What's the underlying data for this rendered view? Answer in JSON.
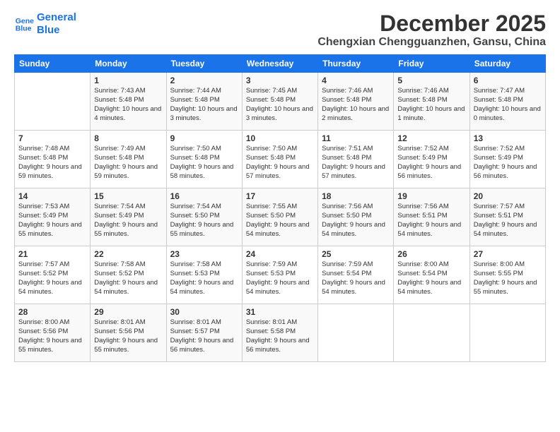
{
  "logo": {
    "line1": "General",
    "line2": "Blue"
  },
  "title": "December 2025",
  "location": "Chengxian Chengguanzhen, Gansu, China",
  "days_of_week": [
    "Sunday",
    "Monday",
    "Tuesday",
    "Wednesday",
    "Thursday",
    "Friday",
    "Saturday"
  ],
  "weeks": [
    [
      {
        "day": "",
        "sunrise": "",
        "sunset": "",
        "daylight": ""
      },
      {
        "day": "1",
        "sunrise": "Sunrise: 7:43 AM",
        "sunset": "Sunset: 5:48 PM",
        "daylight": "Daylight: 10 hours and 4 minutes."
      },
      {
        "day": "2",
        "sunrise": "Sunrise: 7:44 AM",
        "sunset": "Sunset: 5:48 PM",
        "daylight": "Daylight: 10 hours and 3 minutes."
      },
      {
        "day": "3",
        "sunrise": "Sunrise: 7:45 AM",
        "sunset": "Sunset: 5:48 PM",
        "daylight": "Daylight: 10 hours and 3 minutes."
      },
      {
        "day": "4",
        "sunrise": "Sunrise: 7:46 AM",
        "sunset": "Sunset: 5:48 PM",
        "daylight": "Daylight: 10 hours and 2 minutes."
      },
      {
        "day": "5",
        "sunrise": "Sunrise: 7:46 AM",
        "sunset": "Sunset: 5:48 PM",
        "daylight": "Daylight: 10 hours and 1 minute."
      },
      {
        "day": "6",
        "sunrise": "Sunrise: 7:47 AM",
        "sunset": "Sunset: 5:48 PM",
        "daylight": "Daylight: 10 hours and 0 minutes."
      }
    ],
    [
      {
        "day": "7",
        "sunrise": "Sunrise: 7:48 AM",
        "sunset": "Sunset: 5:48 PM",
        "daylight": "Daylight: 9 hours and 59 minutes."
      },
      {
        "day": "8",
        "sunrise": "Sunrise: 7:49 AM",
        "sunset": "Sunset: 5:48 PM",
        "daylight": "Daylight: 9 hours and 59 minutes."
      },
      {
        "day": "9",
        "sunrise": "Sunrise: 7:50 AM",
        "sunset": "Sunset: 5:48 PM",
        "daylight": "Daylight: 9 hours and 58 minutes."
      },
      {
        "day": "10",
        "sunrise": "Sunrise: 7:50 AM",
        "sunset": "Sunset: 5:48 PM",
        "daylight": "Daylight: 9 hours and 57 minutes."
      },
      {
        "day": "11",
        "sunrise": "Sunrise: 7:51 AM",
        "sunset": "Sunset: 5:48 PM",
        "daylight": "Daylight: 9 hours and 57 minutes."
      },
      {
        "day": "12",
        "sunrise": "Sunrise: 7:52 AM",
        "sunset": "Sunset: 5:49 PM",
        "daylight": "Daylight: 9 hours and 56 minutes."
      },
      {
        "day": "13",
        "sunrise": "Sunrise: 7:52 AM",
        "sunset": "Sunset: 5:49 PM",
        "daylight": "Daylight: 9 hours and 56 minutes."
      }
    ],
    [
      {
        "day": "14",
        "sunrise": "Sunrise: 7:53 AM",
        "sunset": "Sunset: 5:49 PM",
        "daylight": "Daylight: 9 hours and 55 minutes."
      },
      {
        "day": "15",
        "sunrise": "Sunrise: 7:54 AM",
        "sunset": "Sunset: 5:49 PM",
        "daylight": "Daylight: 9 hours and 55 minutes."
      },
      {
        "day": "16",
        "sunrise": "Sunrise: 7:54 AM",
        "sunset": "Sunset: 5:50 PM",
        "daylight": "Daylight: 9 hours and 55 minutes."
      },
      {
        "day": "17",
        "sunrise": "Sunrise: 7:55 AM",
        "sunset": "Sunset: 5:50 PM",
        "daylight": "Daylight: 9 hours and 54 minutes."
      },
      {
        "day": "18",
        "sunrise": "Sunrise: 7:56 AM",
        "sunset": "Sunset: 5:50 PM",
        "daylight": "Daylight: 9 hours and 54 minutes."
      },
      {
        "day": "19",
        "sunrise": "Sunrise: 7:56 AM",
        "sunset": "Sunset: 5:51 PM",
        "daylight": "Daylight: 9 hours and 54 minutes."
      },
      {
        "day": "20",
        "sunrise": "Sunrise: 7:57 AM",
        "sunset": "Sunset: 5:51 PM",
        "daylight": "Daylight: 9 hours and 54 minutes."
      }
    ],
    [
      {
        "day": "21",
        "sunrise": "Sunrise: 7:57 AM",
        "sunset": "Sunset: 5:52 PM",
        "daylight": "Daylight: 9 hours and 54 minutes."
      },
      {
        "day": "22",
        "sunrise": "Sunrise: 7:58 AM",
        "sunset": "Sunset: 5:52 PM",
        "daylight": "Daylight: 9 hours and 54 minutes."
      },
      {
        "day": "23",
        "sunrise": "Sunrise: 7:58 AM",
        "sunset": "Sunset: 5:53 PM",
        "daylight": "Daylight: 9 hours and 54 minutes."
      },
      {
        "day": "24",
        "sunrise": "Sunrise: 7:59 AM",
        "sunset": "Sunset: 5:53 PM",
        "daylight": "Daylight: 9 hours and 54 minutes."
      },
      {
        "day": "25",
        "sunrise": "Sunrise: 7:59 AM",
        "sunset": "Sunset: 5:54 PM",
        "daylight": "Daylight: 9 hours and 54 minutes."
      },
      {
        "day": "26",
        "sunrise": "Sunrise: 8:00 AM",
        "sunset": "Sunset: 5:54 PM",
        "daylight": "Daylight: 9 hours and 54 minutes."
      },
      {
        "day": "27",
        "sunrise": "Sunrise: 8:00 AM",
        "sunset": "Sunset: 5:55 PM",
        "daylight": "Daylight: 9 hours and 55 minutes."
      }
    ],
    [
      {
        "day": "28",
        "sunrise": "Sunrise: 8:00 AM",
        "sunset": "Sunset: 5:56 PM",
        "daylight": "Daylight: 9 hours and 55 minutes."
      },
      {
        "day": "29",
        "sunrise": "Sunrise: 8:01 AM",
        "sunset": "Sunset: 5:56 PM",
        "daylight": "Daylight: 9 hours and 55 minutes."
      },
      {
        "day": "30",
        "sunrise": "Sunrise: 8:01 AM",
        "sunset": "Sunset: 5:57 PM",
        "daylight": "Daylight: 9 hours and 56 minutes."
      },
      {
        "day": "31",
        "sunrise": "Sunrise: 8:01 AM",
        "sunset": "Sunset: 5:58 PM",
        "daylight": "Daylight: 9 hours and 56 minutes."
      },
      {
        "day": "",
        "sunrise": "",
        "sunset": "",
        "daylight": ""
      },
      {
        "day": "",
        "sunrise": "",
        "sunset": "",
        "daylight": ""
      },
      {
        "day": "",
        "sunrise": "",
        "sunset": "",
        "daylight": ""
      }
    ]
  ]
}
